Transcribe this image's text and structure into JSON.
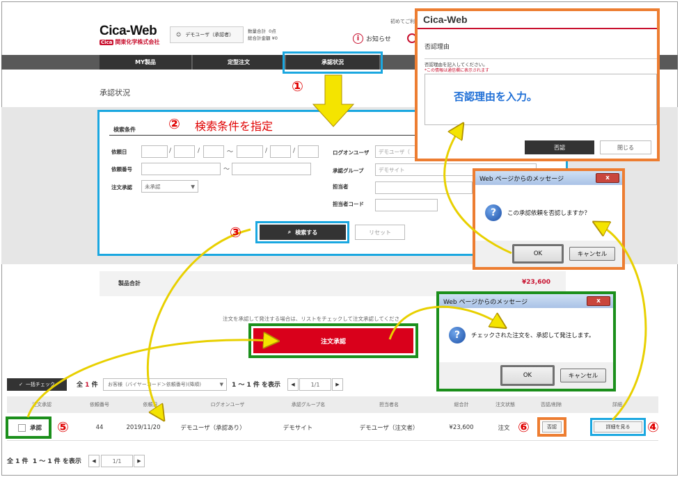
{
  "header": {
    "logo": "Cica-Web",
    "logo_badge": "Cica",
    "company": "関東化学株式会社",
    "user": "デモユーザ（承認者）",
    "cart_count_label": "数量合計",
    "cart_count": "0点",
    "cart_total_label": "総合計金額",
    "cart_total": "¥0",
    "first_time": "初めてご利",
    "notice": "お知らせ"
  },
  "nav": {
    "items": [
      "MY製品",
      "定型注文",
      "承認状況"
    ]
  },
  "page_title": "承認状況",
  "search": {
    "head": "検索条件",
    "annotation": "検索条件を指定",
    "labels": {
      "date": "依頼日",
      "order_no": "依頼番号",
      "approval": "注文承認",
      "login_user": "ログオンユーザ",
      "group": "承認グループ",
      "person": "担当者",
      "person_code": "担当者コード"
    },
    "login_user_placeholder": "デモユーザ（",
    "group_placeholder": "デモサイト",
    "approval_value": "未承認",
    "search_btn": "検索する",
    "reset_btn": "リセット"
  },
  "total": {
    "label": "製品合計",
    "value": "¥23,600"
  },
  "instruction": "注文を承認して発注する場合は、リストをチェックして注文承認",
  "instruction_tail": "してくださ",
  "approve_btn": "注文承認",
  "list": {
    "bulk_check": "一括チェック",
    "count_prefix": "全",
    "count_num": "1",
    "count_suffix": "件",
    "sort": "お客様（バイヤーコード＞依頼番号)(降順)",
    "range": "1 ～ 1 件 を表示",
    "page": "1/1",
    "headers": [
      "注文承認",
      "依頼番号",
      "依頼日",
      "ログオンユーザ",
      "承認グループ名",
      "担当者名",
      "総合計",
      "注文状態",
      "否認/削除",
      "詳細"
    ],
    "row": {
      "approve_label": "承認",
      "order_no": "44",
      "date": "2019/11/20",
      "user": "デモユーザ（承認あり）",
      "group": "デモサイト",
      "person": "デモユーザ（注文者）",
      "total": "¥23,600",
      "status": "注文",
      "reject_btn": "否認",
      "detail_btn": "詳細を見る"
    },
    "footer_count": "全 1 件",
    "footer_range": "1 ～ 1 件 を表示"
  },
  "reject_panel": {
    "logo": "Cica-Web",
    "title": "否認理由",
    "instruction": "否認理由を記入してください。",
    "note": "*この情報は通信欄に表示されます",
    "input_annotation": "否認理由を入力。",
    "reject_btn": "否認",
    "close_btn": "閉じる"
  },
  "dialog_reject": {
    "title": "Web ページからのメッセージ",
    "message": "この承認依頼を否認しますか？",
    "ok": "OK",
    "cancel": "キャンセル"
  },
  "dialog_approve": {
    "title": "Web ページからのメッセージ",
    "message": "チェックされた注文を、承認して発注します。",
    "ok": "OK",
    "cancel": "キャンセル"
  },
  "steps": [
    "①",
    "②",
    "③",
    "④",
    "⑤",
    "⑥"
  ],
  "colors": {
    "accent_red": "#d9001b",
    "highlight_blue": "#1aa7e0",
    "highlight_green": "#1b8f1b",
    "highlight_orange": "#ed7d31",
    "annotation_red": "#e00000"
  }
}
